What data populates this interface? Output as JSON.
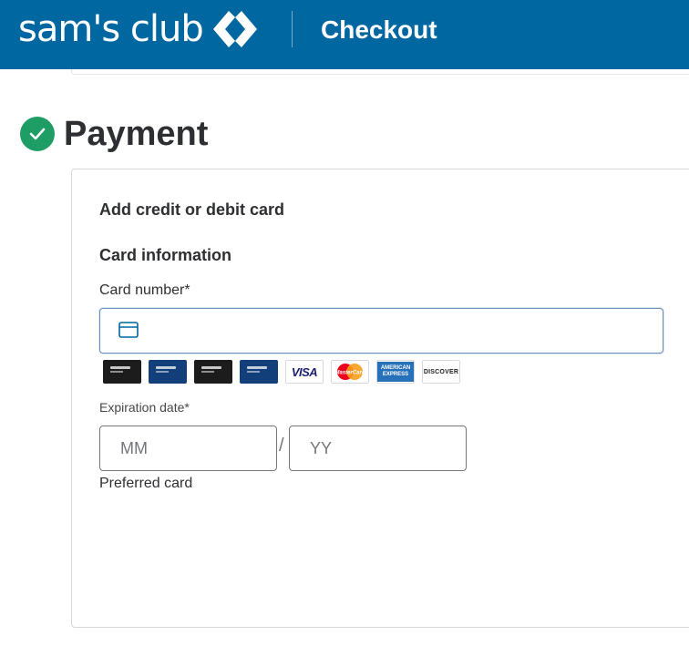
{
  "header": {
    "brand_name": "sam's club",
    "title": "Checkout",
    "background_color": "#0067a0",
    "logo_icon": "sams-club-diamond-icon"
  },
  "section": {
    "title": "Payment",
    "status_icon": "check-circle-icon",
    "status_color": "#1e9e64"
  },
  "form": {
    "heading": "Add credit or debit card",
    "subheading": "Card information",
    "card_number": {
      "label": "Card number*",
      "value": "",
      "icon": "credit-card-icon"
    },
    "accepted_cards": [
      {
        "name": "sams-club-mastercard-black-icon"
      },
      {
        "name": "sams-club-mastercard-blue-icon"
      },
      {
        "name": "sams-club-plus-mastercard-black-icon"
      },
      {
        "name": "sams-club-credit-blue-icon"
      },
      {
        "name": "visa-icon",
        "text": "VISA"
      },
      {
        "name": "mastercard-icon",
        "text": "MasterCard"
      },
      {
        "name": "american-express-icon",
        "text": "AMERICAN EXPRESS"
      },
      {
        "name": "discover-icon",
        "text": "DISCOVER"
      }
    ],
    "expiration": {
      "label": "Expiration date*",
      "month_placeholder": "MM",
      "year_placeholder": "YY",
      "separator": "/"
    },
    "preferred_label": "Preferred card"
  }
}
